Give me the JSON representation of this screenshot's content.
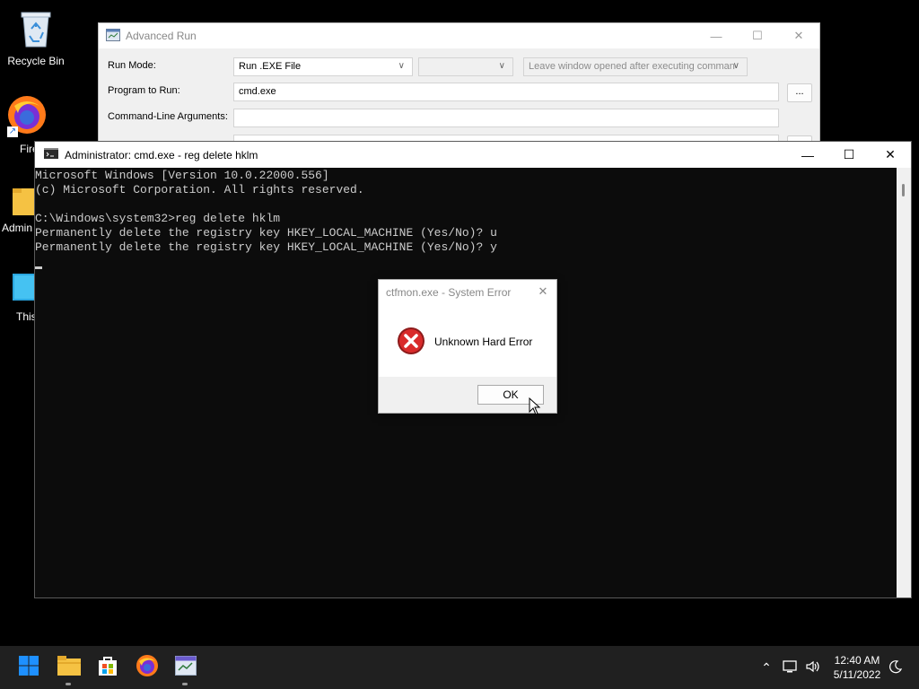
{
  "desktop": {
    "icons": [
      {
        "label": "Recycle Bin"
      },
      {
        "label": "Fire"
      },
      {
        "label": "Admin"
      },
      {
        "label": "This"
      }
    ]
  },
  "advanced_run": {
    "title": "Advanced Run",
    "run_mode_label": "Run Mode:",
    "run_mode_value": "Run .EXE File",
    "window_option_value": "Leave window opened after executing comman",
    "program_label": "Program to Run:",
    "program_value": "cmd.exe",
    "browse_label": "...",
    "args_label": "Command-Line Arguments:",
    "args_value": ""
  },
  "cmd": {
    "title": "Administrator: cmd.exe - reg  delete hklm",
    "lines": [
      "Microsoft Windows [Version 10.0.22000.556]",
      "(c) Microsoft Corporation. All rights reserved.",
      "",
      "C:\\Windows\\system32>reg delete hklm",
      "Permanently delete the registry key HKEY_LOCAL_MACHINE (Yes/No)? u",
      "Permanently delete the registry key HKEY_LOCAL_MACHINE (Yes/No)? y"
    ]
  },
  "dialog": {
    "title": "ctfmon.exe - System Error",
    "message": "Unknown Hard Error",
    "ok_label": "OK"
  },
  "taskbar": {
    "time": "12:40 AM",
    "date": "5/11/2022"
  },
  "colors": {
    "error_red": "#d92b2b",
    "start_blue": "#1e90ff",
    "folder_yellow": "#f5c243"
  }
}
